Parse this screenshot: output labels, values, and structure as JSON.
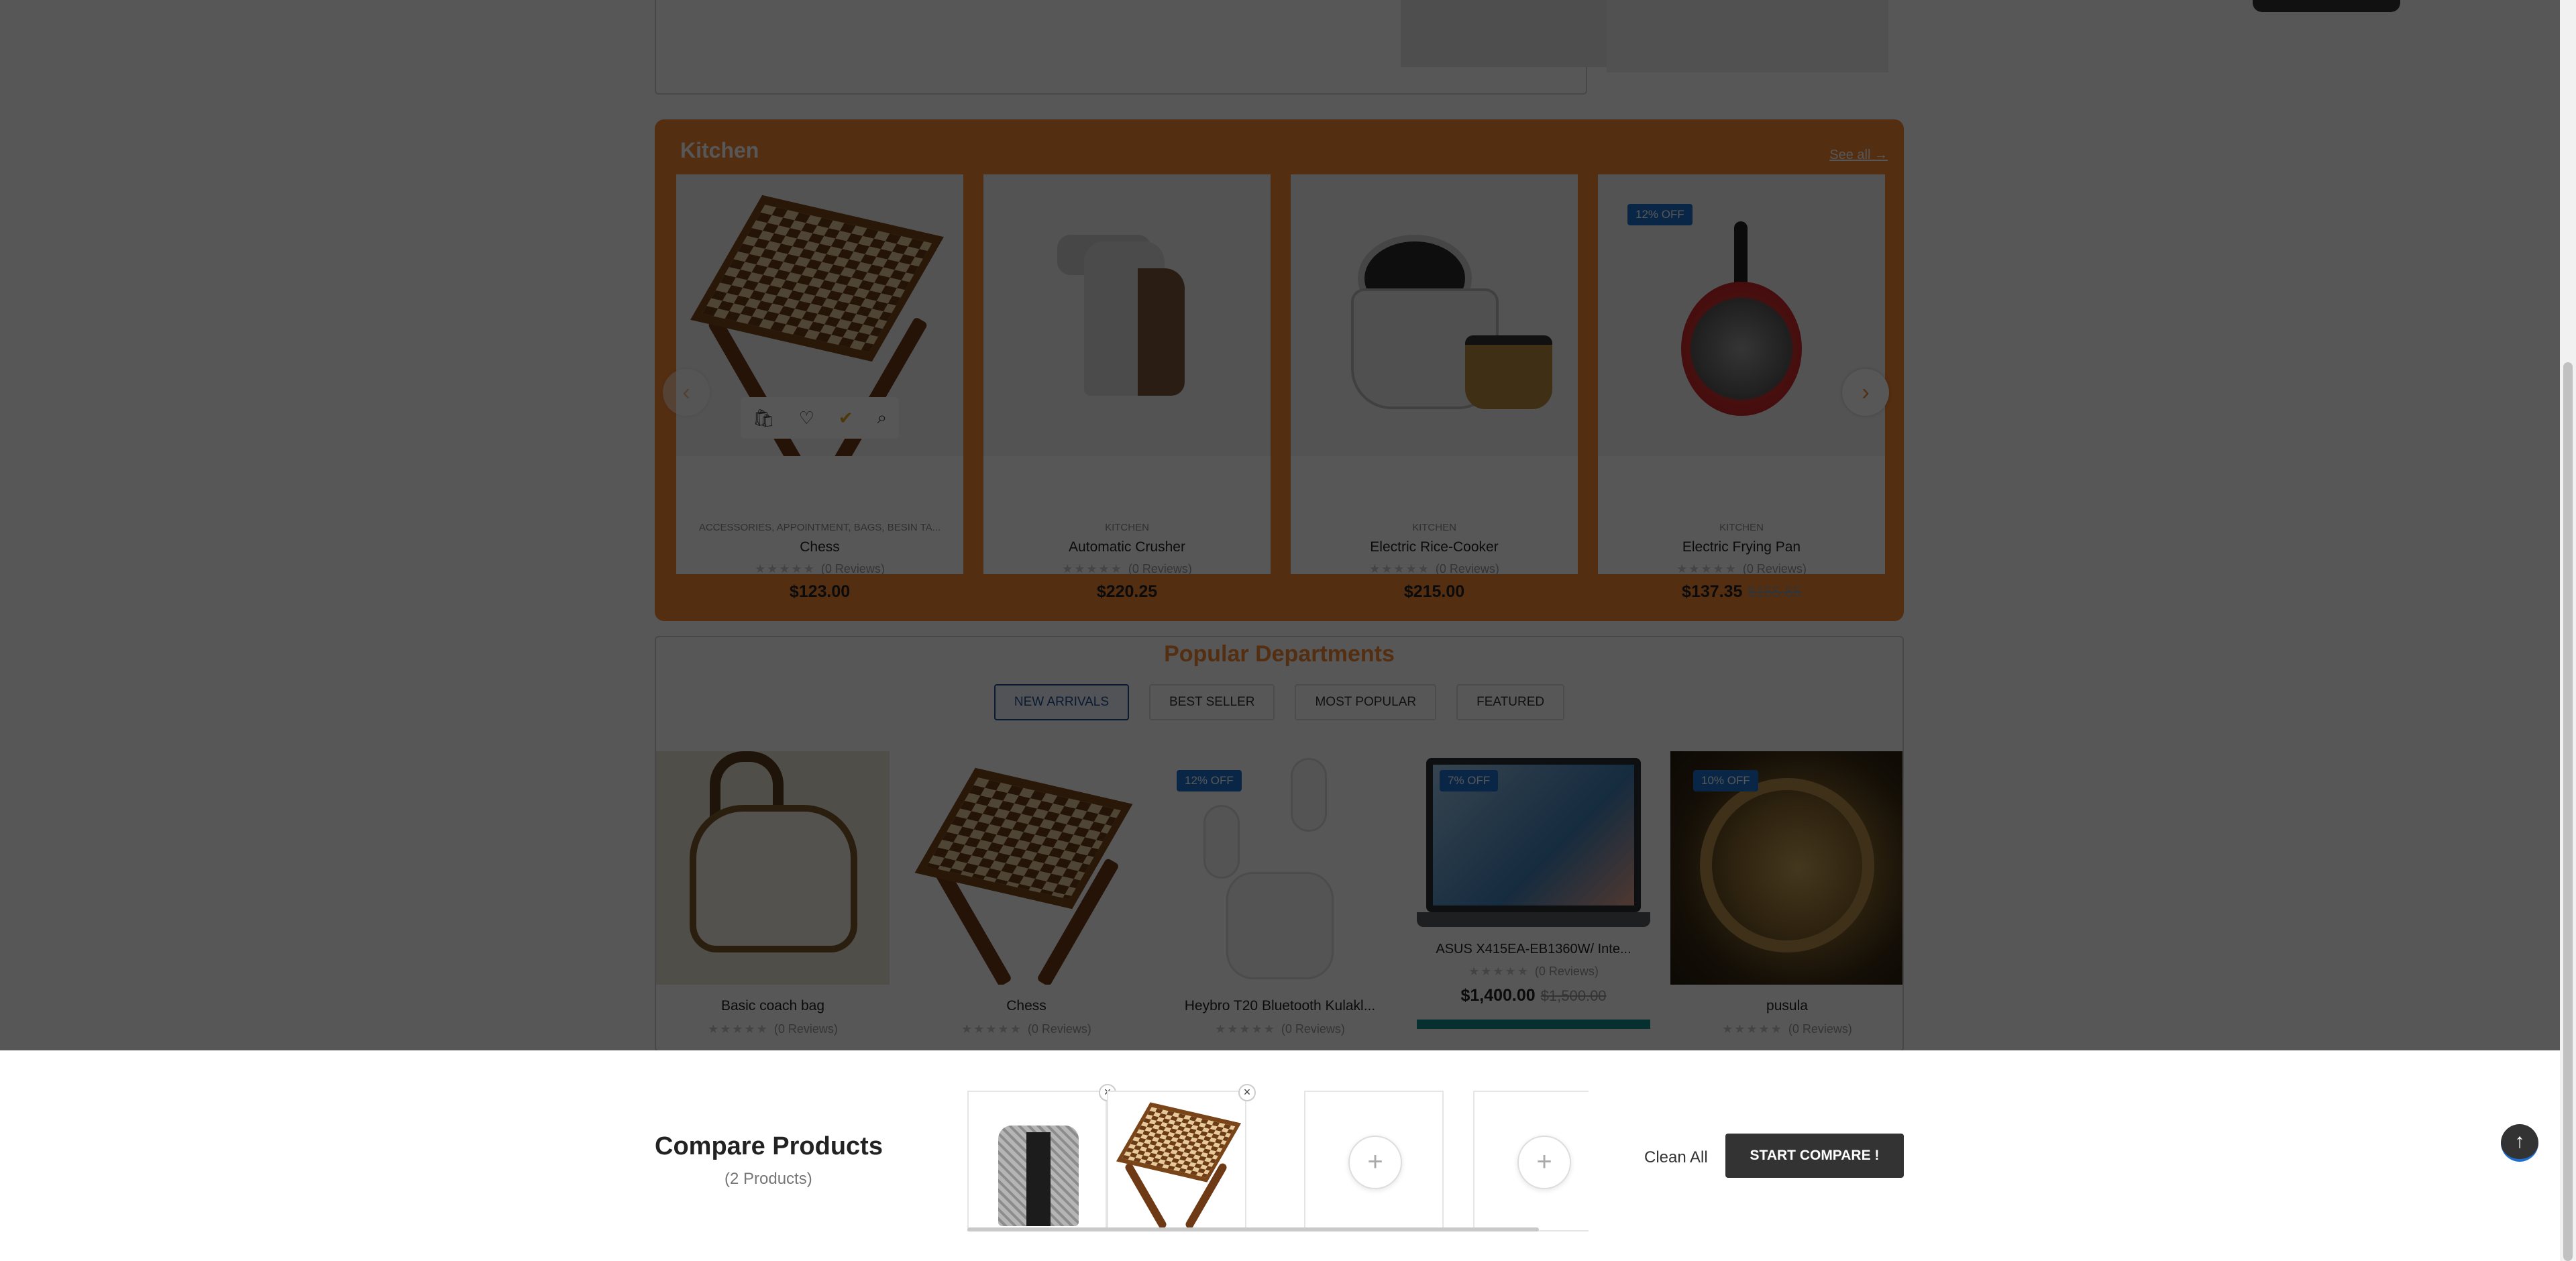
{
  "kitchen": {
    "title": "Kitchen",
    "see_all": "See all →",
    "products": [
      {
        "category": "ACCESSORIES, APPOINTMENT, BAGS, BESIN TA...",
        "name": "Chess",
        "rating_text": "(0 Reviews)",
        "price": "$123.00"
      },
      {
        "category": "KITCHEN",
        "name": "Automatic Crusher",
        "rating_text": "(0 Reviews)",
        "price": "$220.25"
      },
      {
        "category": "KITCHEN",
        "name": "Electric Rice-Cooker",
        "rating_text": "(0 Reviews)",
        "price": "$215.00"
      },
      {
        "category": "KITCHEN",
        "name": "Electric Frying Pan",
        "rating_text": "(0 Reviews)",
        "price": "$137.35",
        "old_price": "$155.65",
        "badge": "12% OFF"
      }
    ]
  },
  "popular": {
    "title": "Popular Departments",
    "tabs": [
      "NEW ARRIVALS",
      "BEST SELLER",
      "MOST POPULAR",
      "FEATURED"
    ],
    "products": [
      {
        "name": "Basic coach bag",
        "rating_text": "(0 Reviews)"
      },
      {
        "name": "Chess",
        "rating_text": "(0 Reviews)"
      },
      {
        "name": "Heybro T20 Bluetooth Kulakl...",
        "rating_text": "(0 Reviews)",
        "badge": "12% OFF"
      },
      {
        "name": "ASUS X415EA-EB1360W/ Inte...",
        "rating_text": "(0 Reviews)",
        "price": "$1,400.00",
        "old_price": "$1,500.00",
        "badge": "7% OFF"
      },
      {
        "name": "pusula",
        "rating_text": "(0 Reviews)",
        "badge": "10% OFF"
      }
    ]
  },
  "compare": {
    "title": "Compare Products",
    "count": "(2 Products)",
    "clean_all": "Clean All",
    "start_label": "START COMPARE !",
    "close_glyph": "×",
    "add_glyph": "+"
  },
  "icons": {
    "cart": "🛍",
    "heart": "♡",
    "check": "✔",
    "search": "⌕",
    "prev": "‹",
    "next": "›",
    "up": "↑",
    "stars": "★★★★★"
  },
  "colors": {
    "accent": "#f58634",
    "badge": "#1f6fd1",
    "button": "#333333"
  }
}
